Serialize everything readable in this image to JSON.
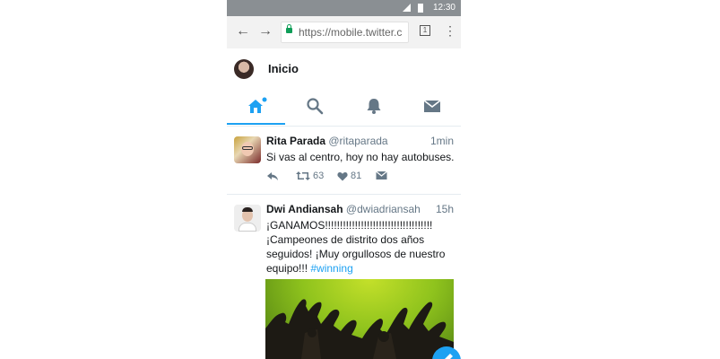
{
  "status_bar": {
    "time": "12:30"
  },
  "browser": {
    "url": "https://mobile.twitter.c",
    "tab_count": "1"
  },
  "header": {
    "title": "Inicio"
  },
  "nav": [
    {
      "name": "home",
      "icon": "home-icon"
    },
    {
      "name": "search",
      "icon": "search-icon"
    },
    {
      "name": "notifications",
      "icon": "bell-icon"
    },
    {
      "name": "messages",
      "icon": "mail-icon"
    }
  ],
  "tweets": [
    {
      "name": "Rita Parada",
      "handle": "@ritaparada",
      "time": "1min",
      "text": "Si vas al centro, hoy no hay autobuses.",
      "retweets": "63",
      "likes": "81"
    },
    {
      "name": "Dwi Andiansah",
      "handle": "@dwiadriansah",
      "time": "15h",
      "text_line1": "¡GANAMOS!!!!!!!!!!!!!!!!!!!!!!!!!!!!!!!!!!!!",
      "text_line2": "¡Campeones de distrito dos años",
      "text_line3": "seguidos! ¡Muy orgullosos de nuestro",
      "text_line4_plain": "equipo!!! ",
      "hashtag": "#winning"
    }
  ],
  "colors": {
    "accent": "#1da1f2",
    "status_bar": "#8a8f93",
    "secondary_text": "#657786"
  }
}
